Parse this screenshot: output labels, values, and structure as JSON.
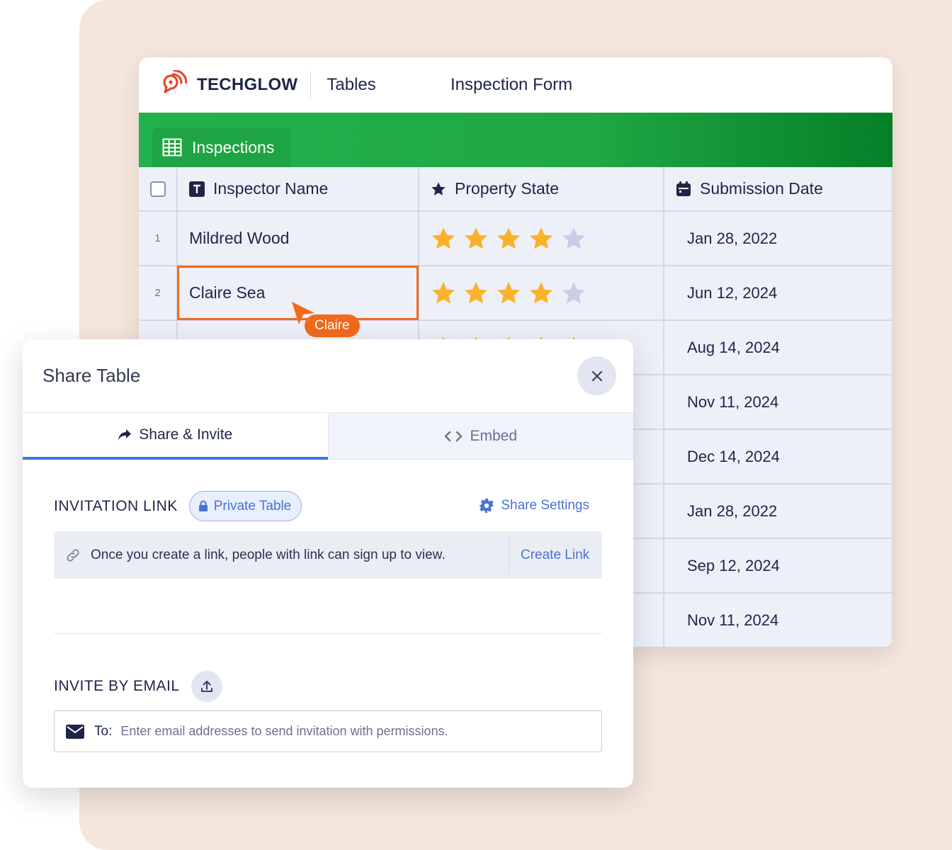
{
  "header": {
    "brand": "TECHGLOW",
    "section": "Tables",
    "form_title": "Inspection Form",
    "brand_color": "#e8482c"
  },
  "table_tab": {
    "label": "Inspections",
    "color": "#1ea444"
  },
  "columns": [
    {
      "label": "Inspector Name",
      "icon": "text-type-icon"
    },
    {
      "label": "Property State",
      "icon": "star-icon"
    },
    {
      "label": "Submission Date",
      "icon": "calendar-icon"
    }
  ],
  "rows": [
    {
      "num": "1",
      "name": "Mildred Wood",
      "rating": 4,
      "date": "Jan 28, 2022"
    },
    {
      "num": "2",
      "name": "Claire Sea",
      "rating": 4,
      "date": "Jun 12, 2024"
    },
    {
      "num": "",
      "name": "",
      "rating": 5,
      "date": "Aug 14, 2024"
    },
    {
      "num": "",
      "name": "",
      "rating": null,
      "date": "Nov 11, 2024"
    },
    {
      "num": "",
      "name": "",
      "rating": null,
      "date": "Dec 14, 2024"
    },
    {
      "num": "",
      "name": "",
      "rating": null,
      "date": "Jan 28, 2022"
    },
    {
      "num": "",
      "name": "",
      "rating": null,
      "date": "Sep 12, 2024"
    },
    {
      "num": "",
      "name": "",
      "rating": null,
      "date": "Nov 11, 2024"
    }
  ],
  "collaborator_cursor": {
    "label": "Claire",
    "color": "#f26a1b"
  },
  "dialog": {
    "title": "Share Table",
    "tabs": [
      {
        "label": "Share & Invite",
        "icon": "share-arrow-icon",
        "active": true
      },
      {
        "label": "Embed",
        "icon": "code-icon",
        "active": false
      }
    ],
    "invitation": {
      "title": "INVITATION LINK",
      "badge": "Private Table",
      "settings_label": "Share Settings",
      "link_text": "Once you create a link, people with link can sign up to view.",
      "create_label": "Create Link"
    },
    "email": {
      "title": "INVITE BY EMAIL",
      "to_label": "To:",
      "placeholder": "Enter email addresses to send invitation with permissions."
    }
  }
}
